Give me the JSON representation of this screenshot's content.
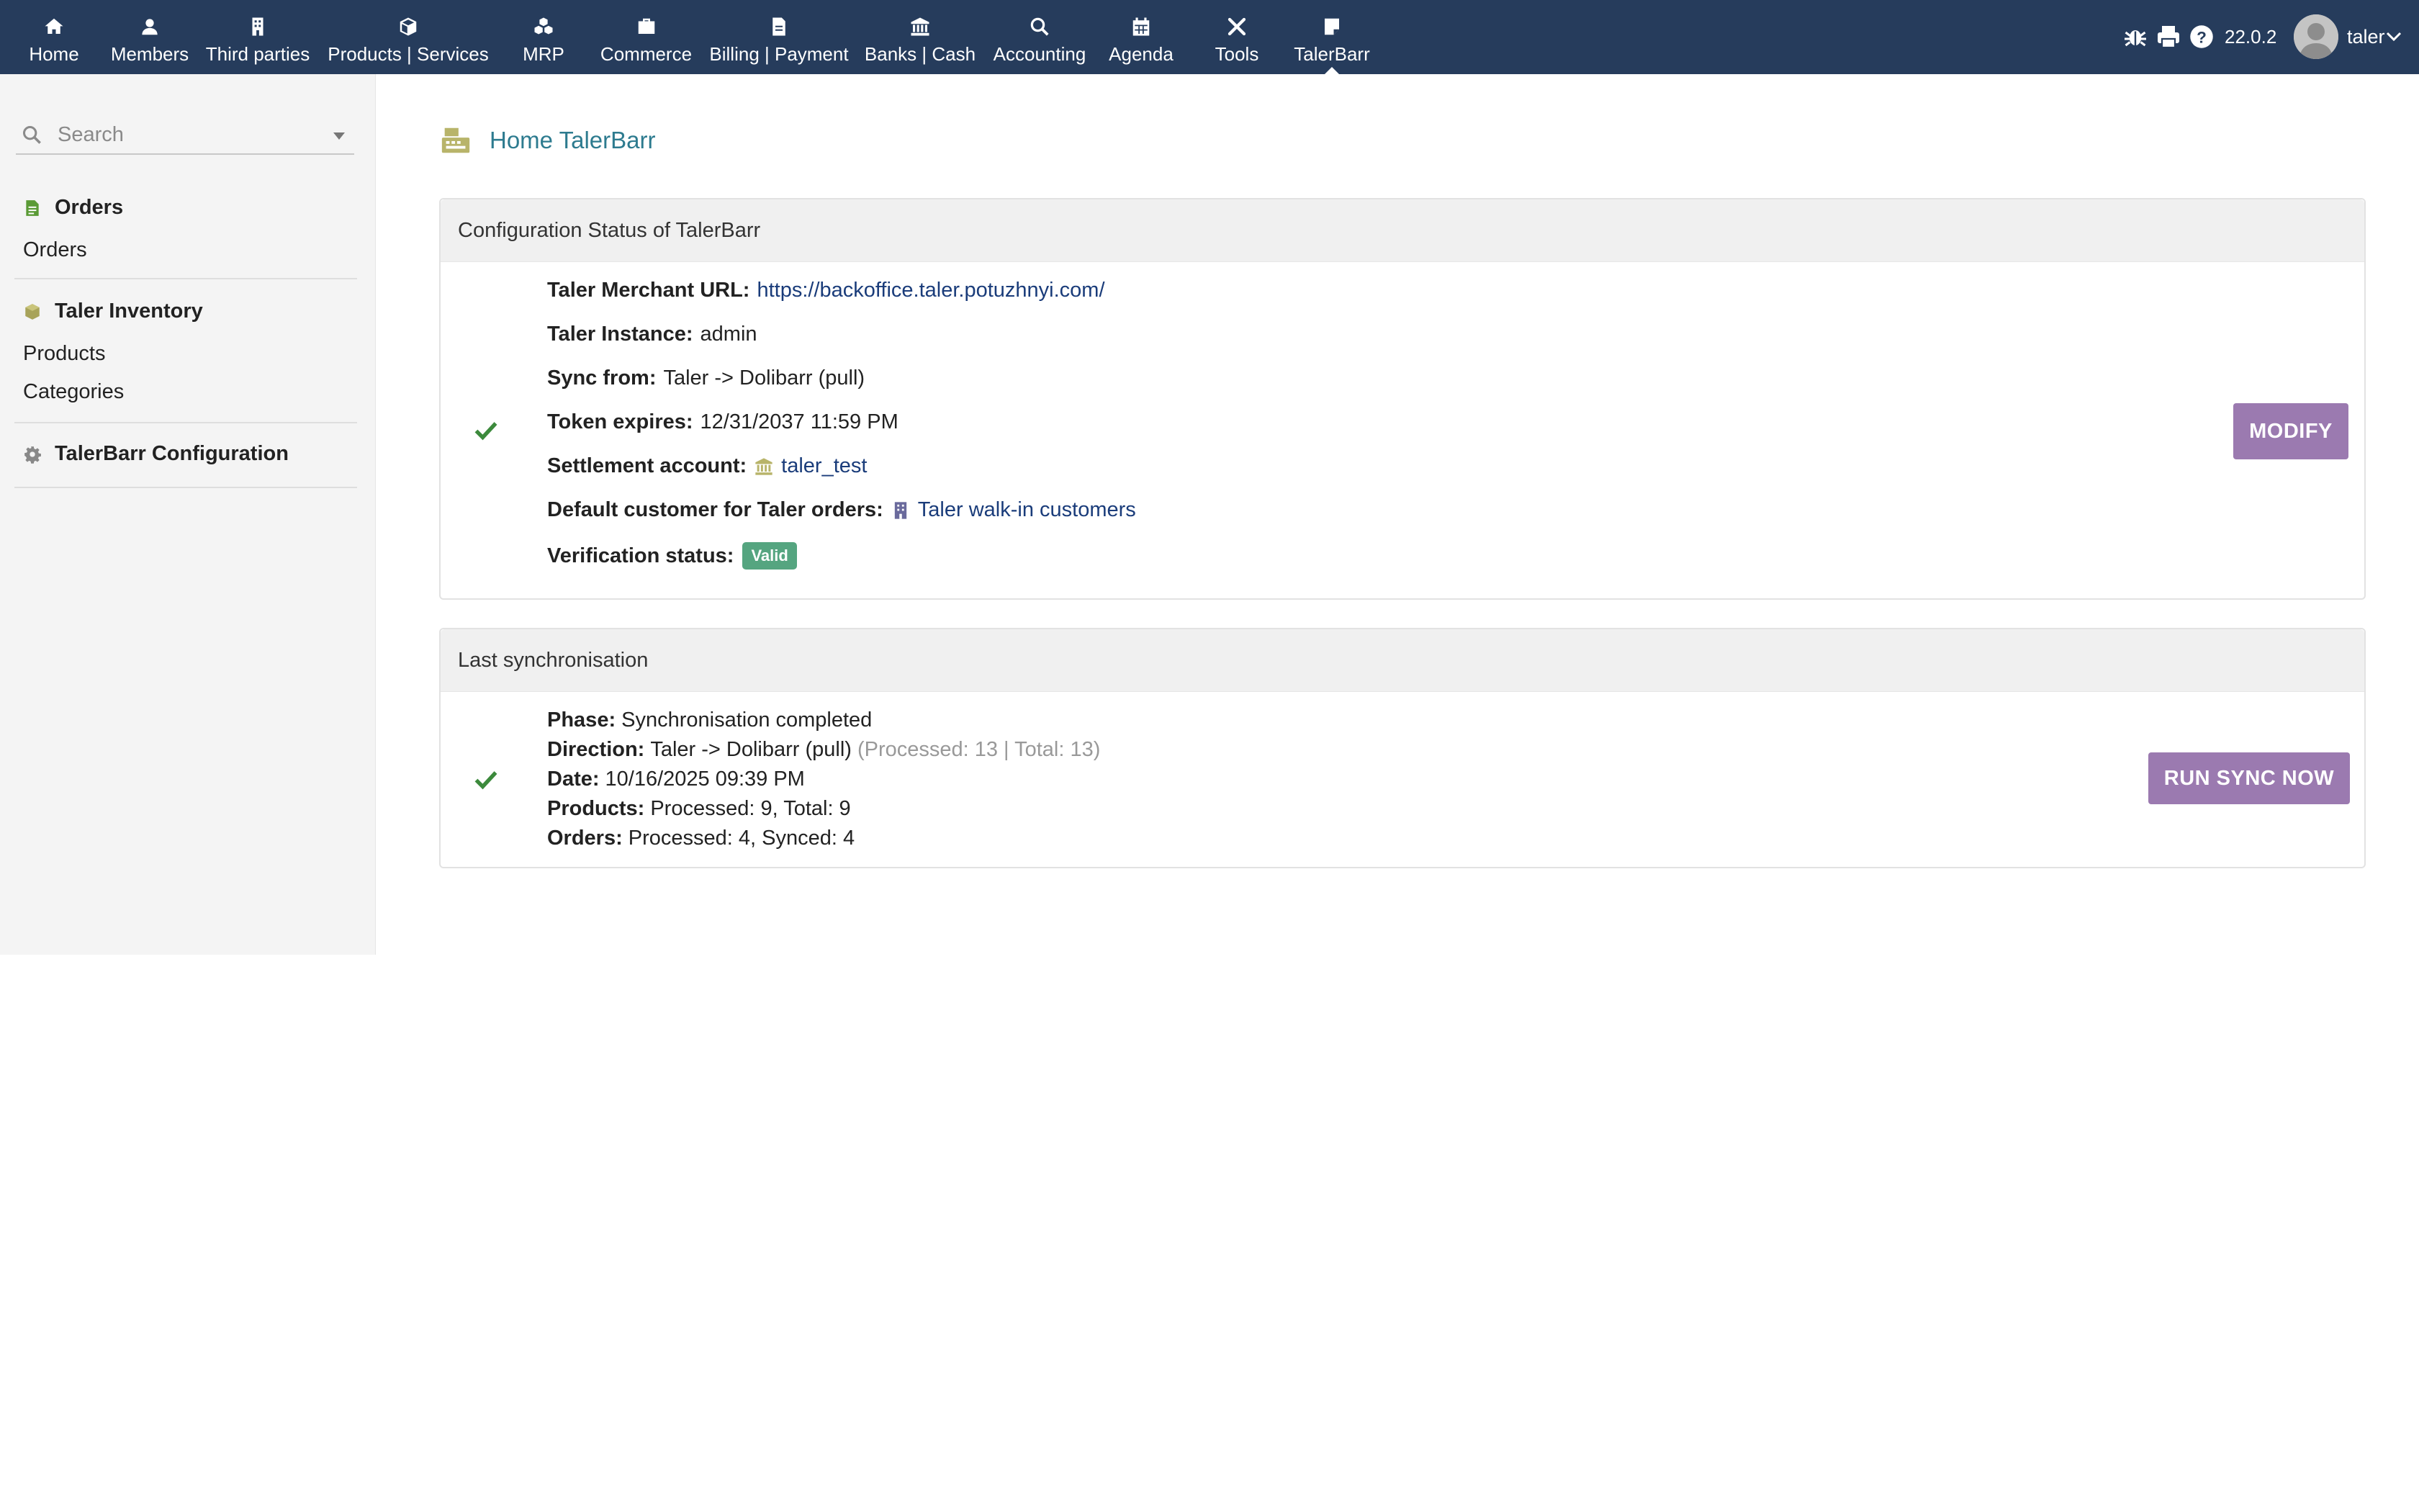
{
  "nav": {
    "items": [
      {
        "label": "Home",
        "icon": "home-icon"
      },
      {
        "label": "Members",
        "icon": "user-icon"
      },
      {
        "label": "Third parties",
        "icon": "building-icon"
      },
      {
        "label": "Products | Services",
        "icon": "cube-icon"
      },
      {
        "label": "MRP",
        "icon": "cubes-icon"
      },
      {
        "label": "Commerce",
        "icon": "briefcase-icon"
      },
      {
        "label": "Billing | Payment",
        "icon": "invoice-icon"
      },
      {
        "label": "Banks | Cash",
        "icon": "bank-icon"
      },
      {
        "label": "Accounting",
        "icon": "search-dollar-icon"
      },
      {
        "label": "Agenda",
        "icon": "calendar-icon"
      },
      {
        "label": "Tools",
        "icon": "tools-icon"
      },
      {
        "label": "TalerBarr",
        "icon": "note-icon"
      }
    ],
    "active": "TalerBarr",
    "version": "22.0.2",
    "username": "taler"
  },
  "sidebar": {
    "search_placeholder": "Search",
    "sections": [
      {
        "title": "Orders",
        "icon": "orders-icon",
        "items": [
          "Orders"
        ]
      },
      {
        "title": "Taler Inventory",
        "icon": "box-icon",
        "items": [
          "Products",
          "Categories"
        ]
      },
      {
        "title": "TalerBarr Configuration",
        "icon": "gear-icon",
        "items": []
      }
    ]
  },
  "main": {
    "title": "Home TalerBarr",
    "config": {
      "heading": "Configuration Status of TalerBarr",
      "merchant_url_label": "Taler Merchant URL:",
      "merchant_url": "https://backoffice.taler.potuzhnyi.com/",
      "instance_label": "Taler Instance:",
      "instance": "admin",
      "sync_label": "Sync from:",
      "sync": "Taler -> Dolibarr (pull)",
      "token_label": "Token expires:",
      "token": "12/31/2037 11:59 PM",
      "account_label": "Settlement account:",
      "account": "taler_test",
      "customer_label": "Default customer for Taler orders:",
      "customer": "Taler walk-in customers",
      "verification_label": "Verification status:",
      "verification": "Valid",
      "modify_button": "MODIFY"
    },
    "sync": {
      "heading": "Last synchronisation",
      "phase_label": "Phase:",
      "phase": "Synchronisation completed",
      "direction_label": "Direction:",
      "direction": "Taler -> Dolibarr (pull)",
      "direction_stats": "(Processed: 13 | Total: 13)",
      "date_label": "Date:",
      "date": "10/16/2025 09:39 PM",
      "products_label": "Products:",
      "products": "Processed: 9, Total: 9",
      "orders_label": "Orders:",
      "orders": "Processed: 4, Synced: 4",
      "run_button": "RUN SYNC NOW"
    }
  },
  "colors": {
    "topbar": "#263c5c",
    "accent_button": "#9b7ab0",
    "title": "#2d7b8f",
    "badge": "#55a580",
    "check": "#3c8a3c"
  }
}
